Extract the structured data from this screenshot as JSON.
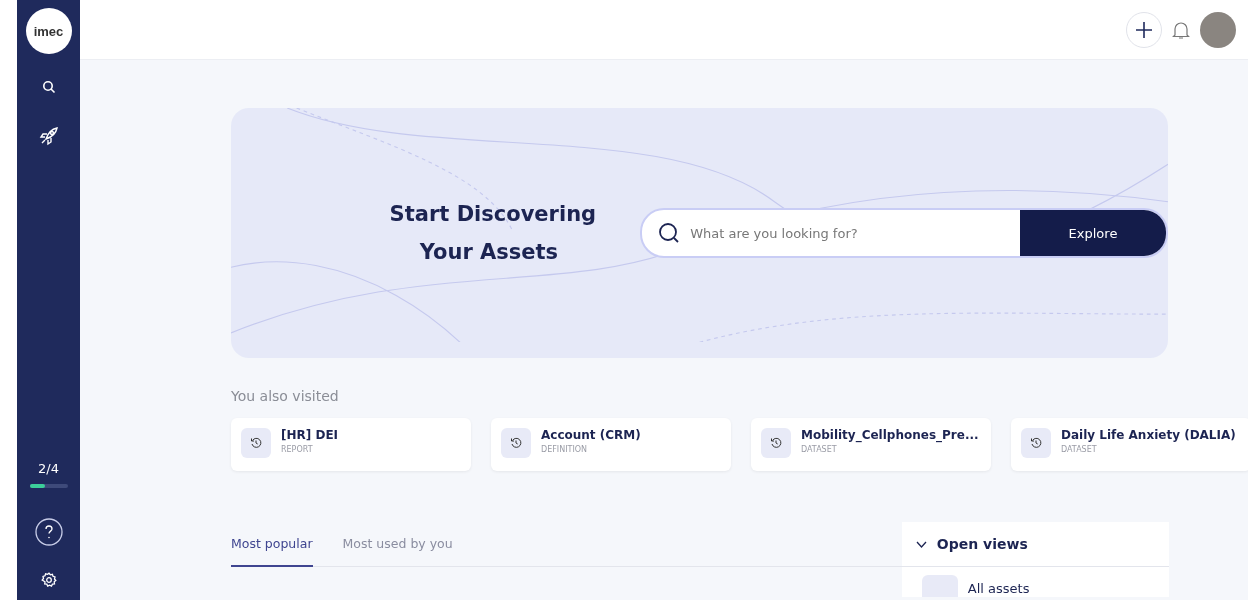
{
  "sidebar": {
    "logo": "imec",
    "progress": {
      "reading": "2/4",
      "level": 0.4
    }
  },
  "hero": {
    "title_line_1": "Start Discovering",
    "title_line_2": "Your Assets",
    "search": {
      "placeholder": "What are you looking for?"
    },
    "button": "Explore"
  },
  "visited": {
    "heading": "You also visited",
    "items": [
      {
        "name": "[HR] DEI",
        "type": "REPORT"
      },
      {
        "name": "Account (CRM)",
        "type": "DEFINITION"
      },
      {
        "name": "Mobility_Cellphones_Pre...",
        "type": "DATASET"
      },
      {
        "name": "Daily Life Anxiety (DALIA)",
        "type": "DATASET"
      }
    ]
  },
  "tabs": [
    {
      "label": "Most popular",
      "selected": true
    },
    {
      "label": "Most used by you",
      "selected": false
    }
  ],
  "open_views": {
    "title": "Open views",
    "expanded": true,
    "items": [
      "All assets"
    ]
  }
}
